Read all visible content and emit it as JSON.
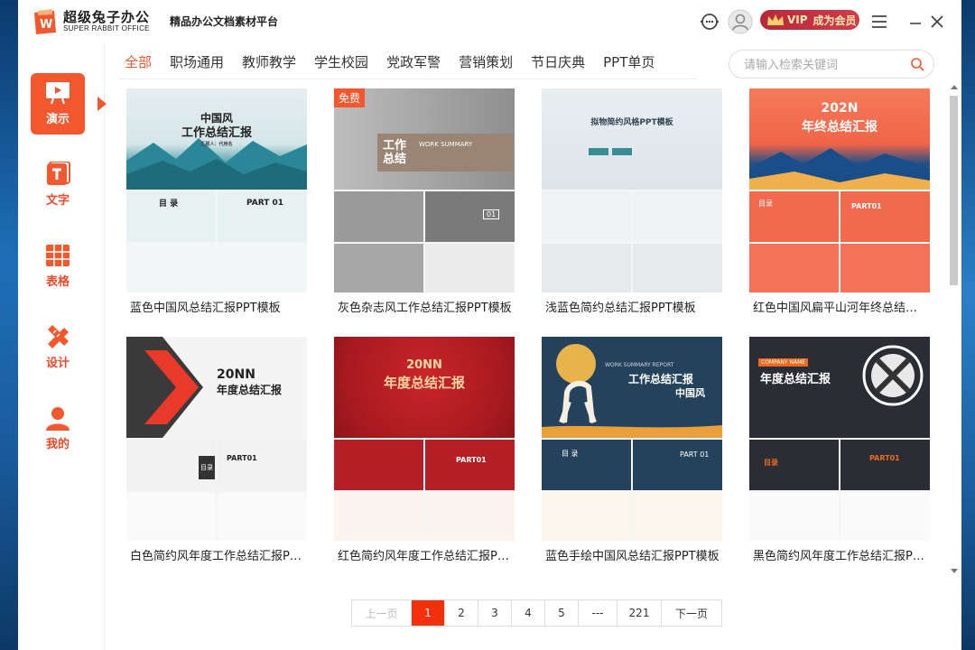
{
  "app": {
    "name": "超级兔子办公",
    "subname": "SUPER RABBIT OFFICE",
    "logo_letter": "W",
    "platform_title": "精品办公文档素材平台",
    "vip_label": "成为会员",
    "vip_tag": "VIP"
  },
  "sidebar": {
    "items": [
      {
        "label": "演示",
        "icon": "presentation-icon",
        "active": true
      },
      {
        "label": "文字",
        "icon": "text-doc-icon"
      },
      {
        "label": "表格",
        "icon": "table-icon"
      },
      {
        "label": "设计",
        "icon": "design-pencil-ruler-icon"
      },
      {
        "label": "我的",
        "icon": "user-icon"
      }
    ]
  },
  "tabs": [
    "全部",
    "职场通用",
    "教师教学",
    "学生校园",
    "党政军警",
    "营销策划",
    "节日庆典",
    "PPT单页"
  ],
  "active_tab": "全部",
  "search": {
    "placeholder": "请输入检索关键词"
  },
  "free_badge": "免费",
  "cards": [
    {
      "title": "蓝色中国风总结汇报PPT模板",
      "cover_title": "中国风",
      "cover_sub": "工作总结汇报",
      "cover_small": "汇报人：代用名",
      "mid_text": "目 录",
      "mid_text2": "PART 01"
    },
    {
      "title": "灰色杂志风工作总结汇报PPT模板",
      "cover_title": "工作",
      "cover_sub": "总结",
      "cover_small": "WORK SUMMARY",
      "mid_text": "01",
      "free": true
    },
    {
      "title": "浅蓝色简约总结汇报PPT模板",
      "cover_title": "拟物简约风格PPT模板"
    },
    {
      "title": "红色中国风扁平山河年终总结汇报PPT模板",
      "cover_title": "202N",
      "cover_sub": "年终总结汇报",
      "mid_text": "目录",
      "mid_text2": "PART01"
    },
    {
      "title": "白色简约风年度工作总结汇报PPT模板",
      "cover_title": "20NN",
      "cover_sub": "年度总结汇报",
      "mid_text": "目录",
      "mid_text2": "PART01"
    },
    {
      "title": "红色简约风年度工作总结汇报PPT模板",
      "cover_title": "20NN",
      "cover_sub": "年度总结汇报",
      "mid_text2": "PART01"
    },
    {
      "title": "蓝色手绘中国风总结汇报PPT模板",
      "cover_title": "工作总结汇报",
      "cover_sub": "中国风",
      "cover_small": "WORK SUMMARY REPORT",
      "mid_text": "目 录",
      "mid_text2": "PART 01"
    },
    {
      "title": "黑色简约风年度工作总结汇报PPT模板",
      "cover_title": "年度总结汇报",
      "cover_small": "COMPANY NAME",
      "mid_text": "目录",
      "mid_text2": "PART01"
    }
  ],
  "pagination": {
    "prev": "上一页",
    "pages": [
      "1",
      "2",
      "3",
      "4",
      "5",
      "---",
      "221"
    ],
    "next": "下一页",
    "current": "1"
  },
  "colors": {
    "accent": "#f2572e",
    "page_active": "#f2300b"
  }
}
